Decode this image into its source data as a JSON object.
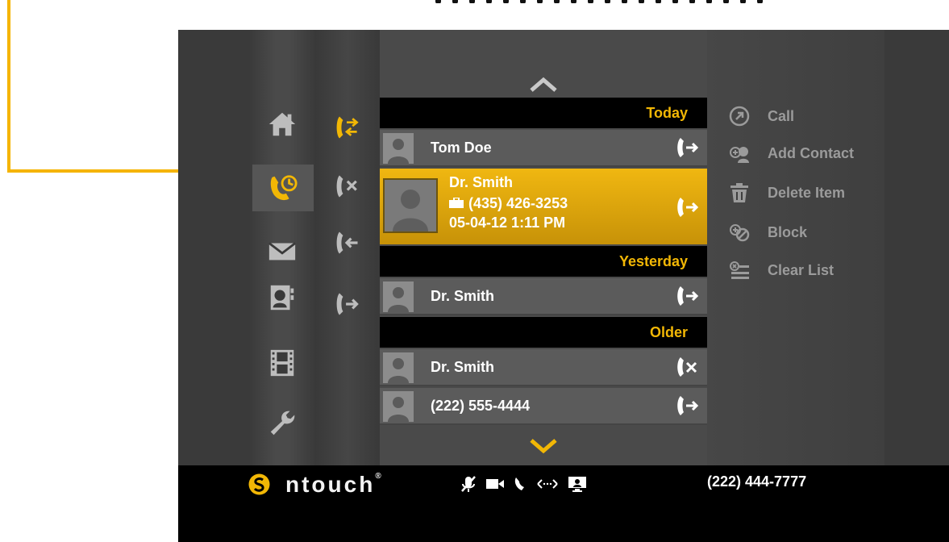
{
  "theme": {
    "accent": "#f2b705",
    "background": "#3a3a3a",
    "row_bg": "#5b5b5b",
    "status_bar": "#000000",
    "callout": "#f5b400"
  },
  "nav": {
    "items": [
      {
        "icon": "home-icon",
        "active": false
      },
      {
        "icon": "call-history-icon",
        "active": true
      },
      {
        "icon": "envelope-icon",
        "active": false
      },
      {
        "icon": "contacts-icon",
        "active": false
      },
      {
        "icon": "film-icon",
        "active": false
      },
      {
        "icon": "wrench-icon",
        "active": false
      }
    ]
  },
  "filters": {
    "items": [
      {
        "icon": "all-calls-icon",
        "active": true
      },
      {
        "icon": "missed-calls-icon",
        "active": false
      },
      {
        "icon": "incoming-calls-icon",
        "active": false
      },
      {
        "icon": "outgoing-calls-icon",
        "active": false
      }
    ]
  },
  "call_list": {
    "groups": [
      {
        "header": "Today",
        "entries": [
          {
            "name": "Tom Doe",
            "direction": "outgoing"
          },
          {
            "name": "Dr. Smith",
            "phone": "(435) 426-3253",
            "phone_type": "work",
            "datetime": "05-04-12  1:11 PM",
            "direction": "outgoing",
            "selected": true
          }
        ]
      },
      {
        "header": "Yesterday",
        "entries": [
          {
            "name": "Dr. Smith",
            "direction": "outgoing"
          }
        ]
      },
      {
        "header": "Older",
        "entries": [
          {
            "name": "Dr. Smith",
            "direction": "missed"
          },
          {
            "name": "(222) 555-4444",
            "direction": "outgoing"
          }
        ]
      }
    ]
  },
  "actions": {
    "call": "Call",
    "add_contact": "Add Contact",
    "delete_item": "Delete Item",
    "block": "Block",
    "clear_list": "Clear List"
  },
  "status_bar": {
    "brand": "ntouch",
    "brand_mark": "®",
    "my_number": "(222) 444-7777",
    "icons": [
      "mic-muted-icon",
      "video-camera-icon",
      "phone-icon",
      "network-icon",
      "monitor-icon"
    ]
  }
}
